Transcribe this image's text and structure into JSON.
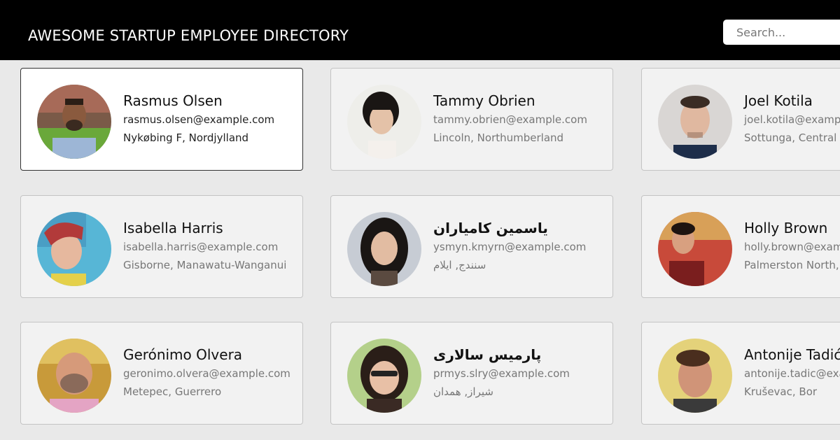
{
  "header": {
    "title": "AWESOME STARTUP EMPLOYEE DIRECTORY",
    "search_placeholder": "Search..."
  },
  "employees": [
    {
      "name": "Rasmus Olsen",
      "email": "rasmus.olsen@example.com",
      "location": "Nykøbing F, Nordjylland",
      "selected": true
    },
    {
      "name": "Tammy Obrien",
      "email": "tammy.obrien@example.com",
      "location": "Lincoln, Northumberland",
      "selected": false
    },
    {
      "name": "Joel Kotila",
      "email": "joel.kotila@example.com",
      "location": "Sottunga, Central Finland",
      "selected": false
    },
    {
      "name": "Isabella Harris",
      "email": "isabella.harris@example.com",
      "location": "Gisborne, Manawatu-Wanganui",
      "selected": false
    },
    {
      "name": "یاسمین کامیاران",
      "email": "ysmyn.kmyrn@example.com",
      "location": "سنندج, ایلام",
      "selected": false
    },
    {
      "name": "Holly Brown",
      "email": "holly.brown@example.com",
      "location": "Palmerston North, Otago",
      "selected": false
    },
    {
      "name": "Gerónimo Olvera",
      "email": "geronimo.olvera@example.com",
      "location": "Metepec, Guerrero",
      "selected": false
    },
    {
      "name": "پارمیس سالاری",
      "email": "prmys.slry@example.com",
      "location": "شیراز, همدان",
      "selected": false
    },
    {
      "name": "Antonije Tadić",
      "email": "antonije.tadic@example.com",
      "location": "Kruševac, Bor",
      "selected": false
    }
  ]
}
